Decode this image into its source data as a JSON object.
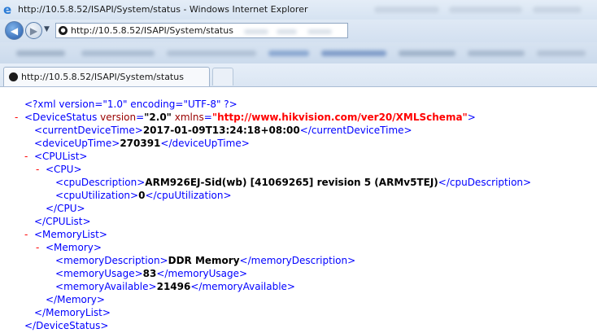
{
  "window": {
    "title": "http://10.5.8.52/ISAPI/System/status - Windows Internet Explorer",
    "address": "http://10.5.8.52/ISAPI/System/status",
    "tab_label": "http://10.5.8.52/ISAPI/System/status"
  },
  "xml": {
    "declaration": "<?xml version=\"1.0\" encoding=\"UTF-8\" ?>",
    "collapse_symbol": "-",
    "device_status": {
      "tag": "DeviceStatus",
      "version_attr": "version",
      "version_val": "\"2.0\"",
      "xmlns_attr": "xmlns",
      "xmlns_val": "\"http://www.hikvision.com/ver20/XMLSchema\""
    },
    "current_device_time": {
      "tag": "currentDeviceTime",
      "value": "2017-01-09T13:24:18+08:00"
    },
    "device_up_time": {
      "tag": "deviceUpTime",
      "value": "270391"
    },
    "cpu_list": {
      "tag": "CPUList",
      "cpu_tag": "CPU",
      "cpu_description": {
        "tag": "cpuDescription",
        "value": "ARM926EJ-Sid(wb) [41069265] revision 5 (ARMv5TEJ)"
      },
      "cpu_utilization": {
        "tag": "cpuUtilization",
        "value": "0"
      }
    },
    "memory_list": {
      "tag": "MemoryList",
      "memory_tag": "Memory",
      "memory_description": {
        "tag": "memoryDescription",
        "value": "DDR Memory"
      },
      "memory_usage": {
        "tag": "memoryUsage",
        "value": "83"
      },
      "memory_available": {
        "tag": "memoryAvailable",
        "value": "21496"
      }
    }
  },
  "icons": {
    "ie_logo": "ie-logo-icon",
    "back": "back-arrow-icon",
    "forward": "forward-arrow-icon",
    "page": "page-globe-icon"
  },
  "colors": {
    "tag": "#0000ff",
    "attribute": "#990000",
    "namespace_value": "#ff0000",
    "collapse_toggle": "#ff0000"
  }
}
